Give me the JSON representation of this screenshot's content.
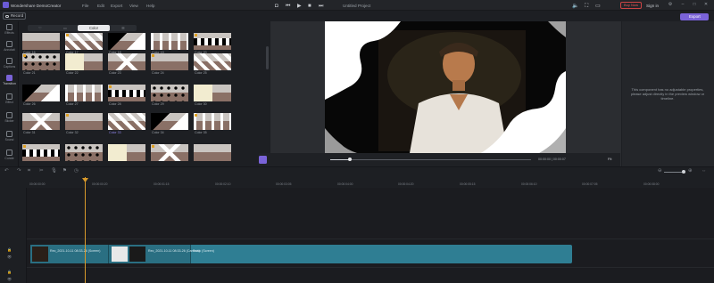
{
  "app": {
    "name": "Wondershare DemoCreator",
    "project_title": "Untitled Project"
  },
  "menu": [
    "File",
    "Edit",
    "Export",
    "View",
    "Help"
  ],
  "titlebar": {
    "buy_now": "Buy Now",
    "sign_in": "Sign in"
  },
  "toolbar": {
    "record_label": "Record",
    "export_label": "Export"
  },
  "rail": [
    {
      "label": "Effects",
      "icon": "effects-icon"
    },
    {
      "label": "Annotati",
      "icon": "annotation-icon"
    },
    {
      "label": "Captions",
      "icon": "captions-icon"
    },
    {
      "label": "Transition",
      "icon": "transition-icon",
      "active": true
    },
    {
      "label": "Effect",
      "icon": "magic-icon"
    },
    {
      "label": "Sticker",
      "icon": "sticker-icon"
    },
    {
      "label": "Sound",
      "icon": "sound-icon"
    },
    {
      "label": "Curate",
      "icon": "curate-icon"
    }
  ],
  "library": {
    "tabs": [
      "",
      "",
      "Color",
      ""
    ],
    "rows": [
      [
        "Color 16",
        "Color 17",
        "Color 18",
        "Color 19",
        "Color 20"
      ],
      [
        "Color 21",
        "Color 22",
        "Color 23",
        "Color 24",
        "Color 25"
      ],
      [
        "Color 26",
        "Color 27",
        "Color 28",
        "Color 29",
        "Color 30"
      ],
      [
        "Color 31",
        "Color 32",
        "Color 33",
        "Color 34",
        "Color 35"
      ],
      [
        "",
        "",
        "",
        "",
        ""
      ]
    ],
    "selected": "Color 33"
  },
  "player": {
    "timecode": "00:00:00 | 00:00:07",
    "fit": "Fit"
  },
  "properties": {
    "message": "This component has no adjustable properties, please adjust directly in the preview window or timeline."
  },
  "timeline": {
    "ruler": [
      "00:00:00:00",
      "00:00:00:20",
      "00:00:01:15",
      "00:00:02:10",
      "00:00:03:05",
      "00:00:04:00",
      "00:00:04:20",
      "00:00:05:15",
      "00:00:06:10",
      "00:00:07:05",
      "00:00:08:00"
    ],
    "clips": [
      "Rec_2021-10-11 08:33-26 (Screen)",
      "Rec_2021-10-11 08:33-26 (Camera)",
      "Rubic (Screen)"
    ]
  },
  "colors": {
    "accent": "#7a63d8",
    "clip": "#2f7e93",
    "playhead": "#d99a2b",
    "buy_now": "#e55555"
  }
}
